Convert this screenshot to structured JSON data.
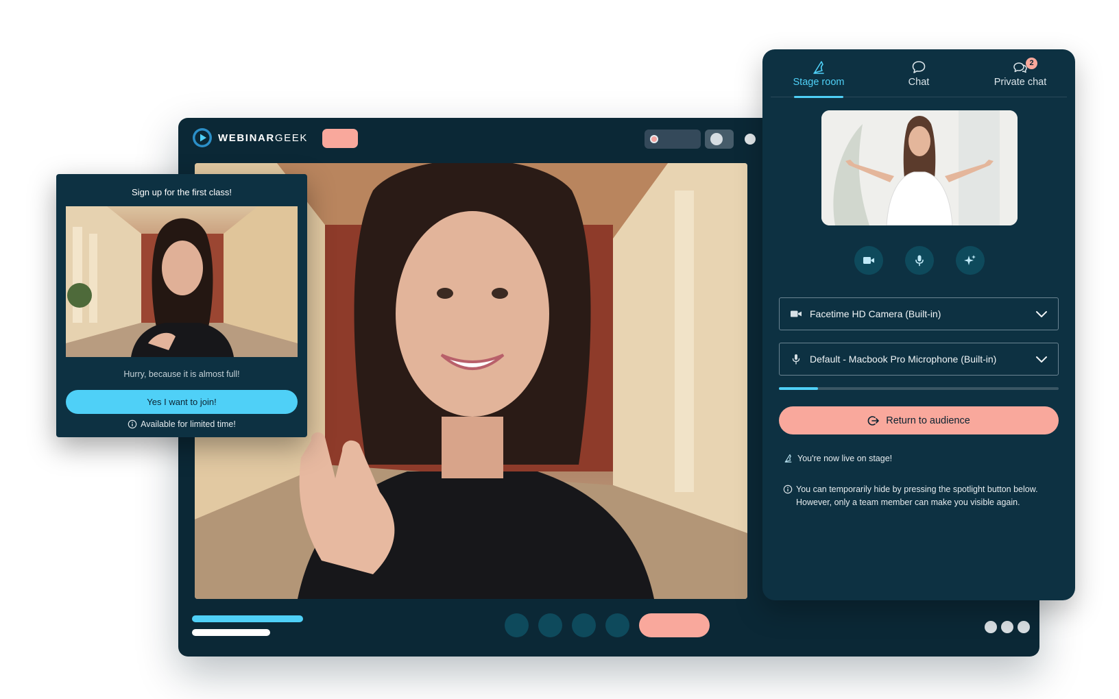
{
  "app": {
    "logo_bold": "WEBINAR",
    "logo_light": "GEEK"
  },
  "signup": {
    "title": "Sign up for the first class!",
    "subtitle": "Hurry, because it is almost full!",
    "button_label": "Yes I want to join!",
    "note": "Available for limited time!"
  },
  "panel": {
    "tabs": [
      {
        "label": "Stage room",
        "icon": "stage-icon",
        "active": true
      },
      {
        "label": "Chat",
        "icon": "chat-bubble-icon",
        "active": false
      },
      {
        "label": "Private chat",
        "icon": "private-chat-icon",
        "active": false,
        "badge": "2"
      }
    ],
    "media_buttons": [
      "camera-icon",
      "microphone-icon",
      "effects-sparkle-icon"
    ],
    "camera_select": {
      "value": "Facetime HD Camera (Built-in)"
    },
    "mic_select": {
      "value": "Default - Macbook Pro Microphone (Built-in)"
    },
    "mic_level": 0.14,
    "return_button": "Return to audience",
    "live_note": "You're now live on stage!",
    "hide_note": "You can temporarily hide by pressing the spotlight button below. However, only a team member can make you visible again."
  },
  "colors": {
    "window_bg": "#0b2836",
    "panel_bg": "#0d3142",
    "accent_blue": "#4fd0f7",
    "accent_salmon": "#f9a89c",
    "control_teal": "#0e4a5c"
  }
}
